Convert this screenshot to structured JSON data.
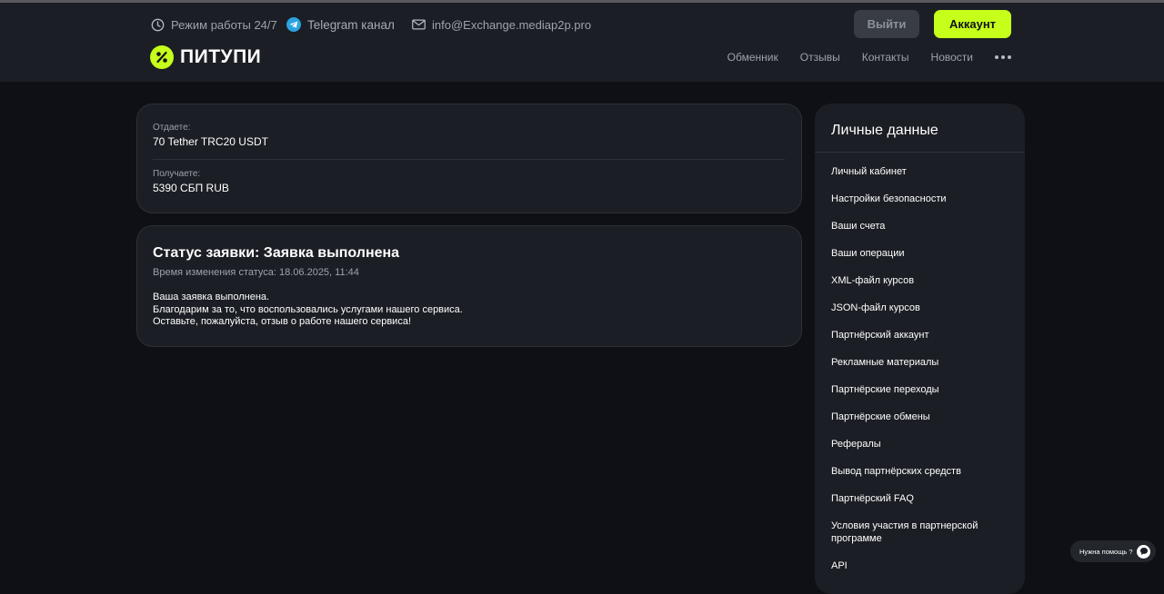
{
  "header": {
    "work_hours": "Режим работы 24/7",
    "telegram": "Telegram канал",
    "email": "info@Exchange.mediap2p.pro",
    "logo_text": "ПИТУПИ",
    "logout_label": "Выйти",
    "account_label": "Аккаунт",
    "nav": [
      "Обменник",
      "Отзывы",
      "Контакты",
      "Новости"
    ]
  },
  "exchange": {
    "give_label": "Отдаете:",
    "give_value": "70 Tether TRC20 USDT",
    "receive_label": "Получаете:",
    "receive_value": "5390 СБП RUB"
  },
  "status": {
    "title": "Статус заявки: Заявка выполнена",
    "time": "Время изменения статуса: 18.06.2025, 11:44",
    "message": [
      "Ваша заявка выполнена.",
      "Благодарим за то, что воспользовались услугами нашего сервиса.",
      "Оставьте, пожалуйста, отзыв о работе нашего сервиса!"
    ]
  },
  "sidebar": {
    "title": "Личные данные",
    "items": [
      "Личный кабинет",
      "Настройки безопасности",
      "Ваши счета",
      "Ваши операции",
      "XML-файл курсов",
      "JSON-файл курсов",
      "Партнёрский аккаунт",
      "Рекламные материалы",
      "Партнёрские переходы",
      "Партнёрские обмены",
      "Рефералы",
      "Вывод партнёрских средств",
      "Партнёрский FAQ",
      "Условия участия в партнерской программе",
      "API"
    ]
  },
  "help": {
    "label": "Нужна помощь ?"
  },
  "colors": {
    "accent": "#c6ff1a",
    "background": "#0f1015",
    "panel": "#1b1e24"
  }
}
